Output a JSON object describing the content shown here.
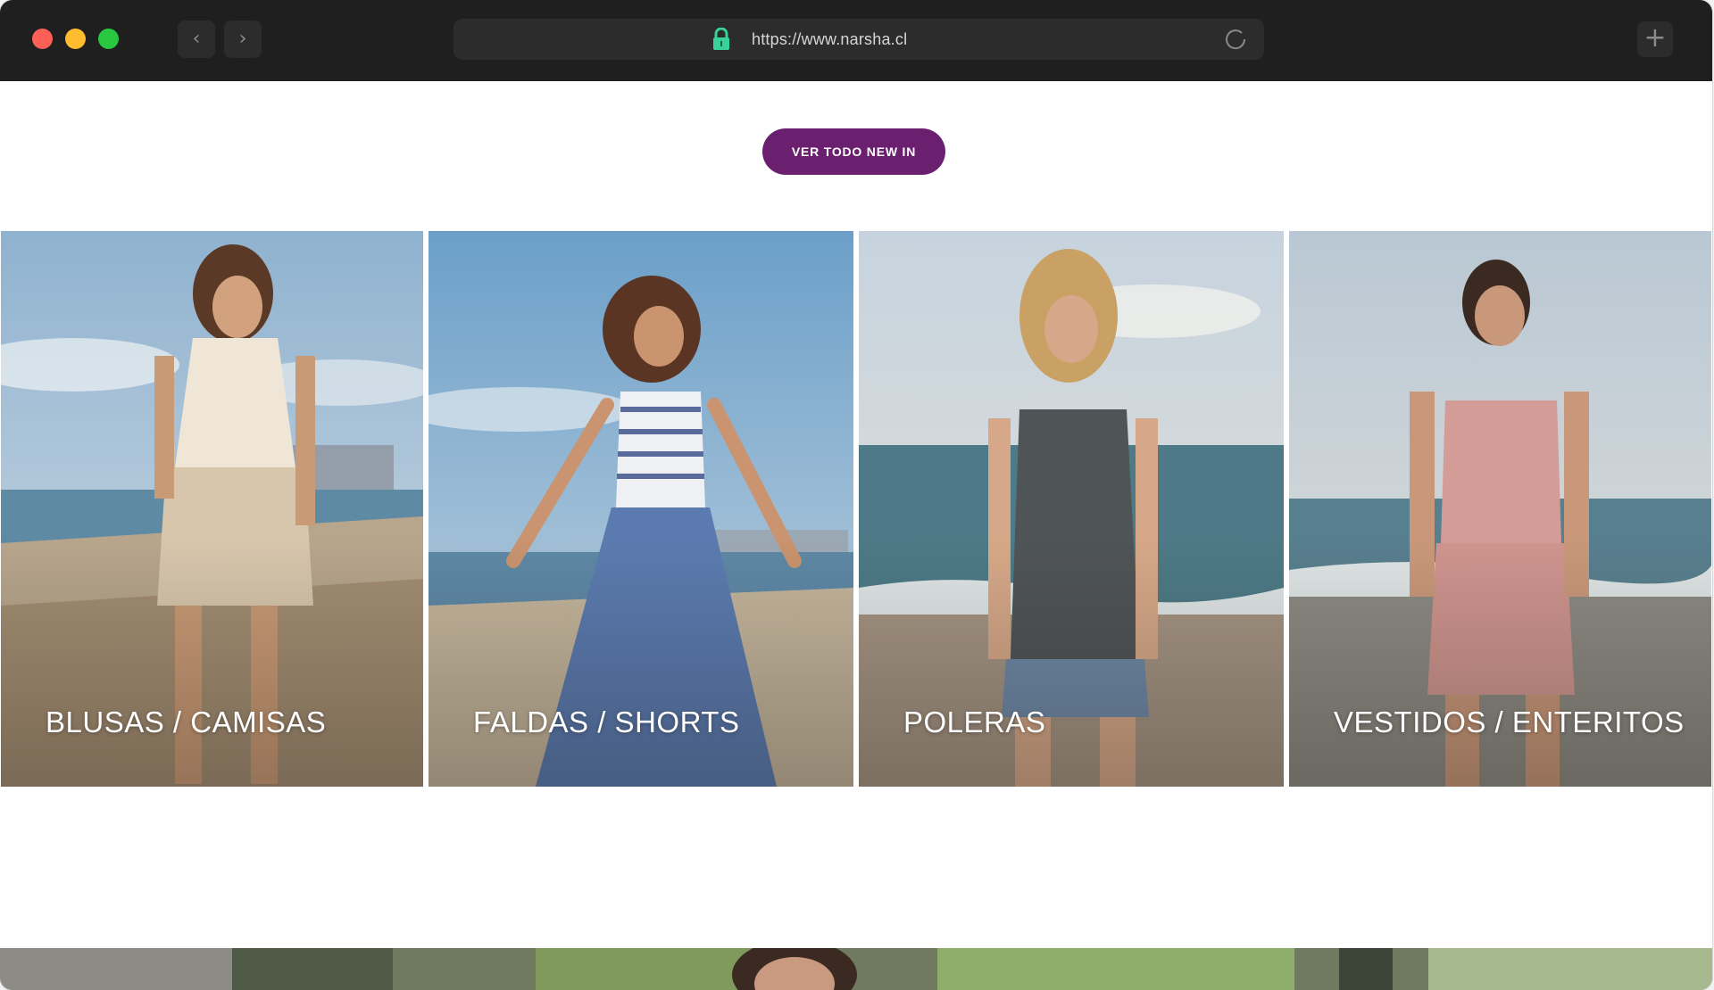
{
  "browser": {
    "url": "https://www.narsha.cl",
    "icons": {
      "back": "chevron-left-icon",
      "forward": "chevron-right-icon",
      "lock": "lock-icon",
      "reload": "reload-icon",
      "new_tab": "plus-icon"
    }
  },
  "page": {
    "cta_label": "VER TODO NEW IN",
    "accent_color": "#6a1f6f",
    "categories": [
      {
        "label": "BLUSAS / CAMISAS"
      },
      {
        "label": "FALDAS / SHORTS"
      },
      {
        "label": "POLERAS"
      },
      {
        "label": "VESTIDOS / ENTERITOS"
      }
    ]
  }
}
